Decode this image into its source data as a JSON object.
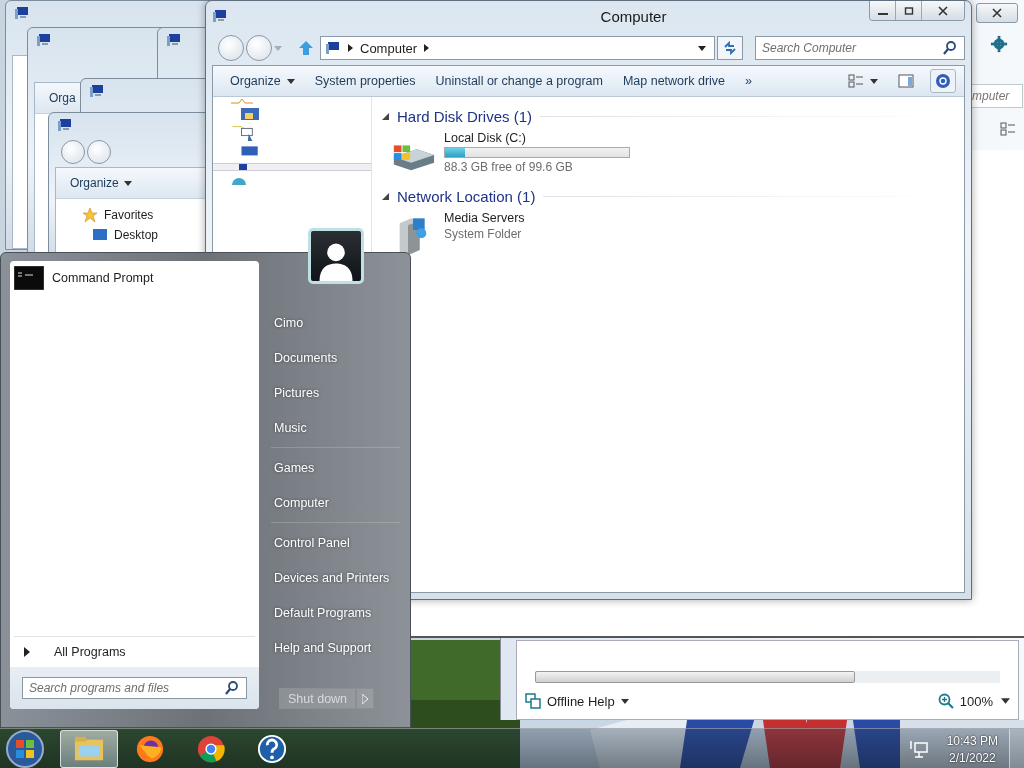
{
  "stacked_windows": {
    "cut_label": "Orga",
    "organize": "Organize",
    "favorites": "Favorites",
    "desktop": "Desktop"
  },
  "help_window": {
    "search_cut": "mputer",
    "status": "Offline Help",
    "zoom": "100%"
  },
  "explorer": {
    "title": "Computer",
    "address": "Computer",
    "search": {
      "placeholder": "Search Computer"
    },
    "commands": [
      {
        "label": "Organize",
        "menu": true
      },
      {
        "label": "System properties",
        "menu": false
      },
      {
        "label": "Uninstall or change a program",
        "menu": false
      },
      {
        "label": "Map network drive",
        "menu": false
      }
    ],
    "more": "»",
    "groups": [
      {
        "title": "Hard Disk Drives (1)",
        "expanded": true,
        "items": [
          {
            "kind": "drive",
            "name": "Local Disk (C:)",
            "level": 0.11,
            "detail": "88.3 GB free of 99.6 GB"
          }
        ]
      },
      {
        "title": "Network Location (1)",
        "expanded": true,
        "items": [
          {
            "kind": "media",
            "name": "Media Servers",
            "detail": "System Folder"
          }
        ]
      }
    ]
  },
  "start_menu": {
    "programs": [
      {
        "name": "Command Prompt"
      }
    ],
    "all_programs": "All Programs",
    "search": {
      "placeholder": "Search programs and files"
    },
    "places": [
      [
        "Cimo",
        "Documents",
        "Pictures",
        "Music"
      ],
      [
        "Games",
        "Computer"
      ],
      [
        "Control Panel",
        "Devices and Printers",
        "Default Programs",
        "Help and Support"
      ]
    ],
    "shutdown": "Shut down"
  },
  "taskbar": {
    "apps": [
      {
        "kind": "explorer",
        "active": true
      },
      {
        "kind": "firefox",
        "active": false
      },
      {
        "kind": "chrome",
        "active": false
      },
      {
        "kind": "help",
        "active": false
      }
    ],
    "time": "10:43 PM",
    "date": "2/1/2022"
  }
}
